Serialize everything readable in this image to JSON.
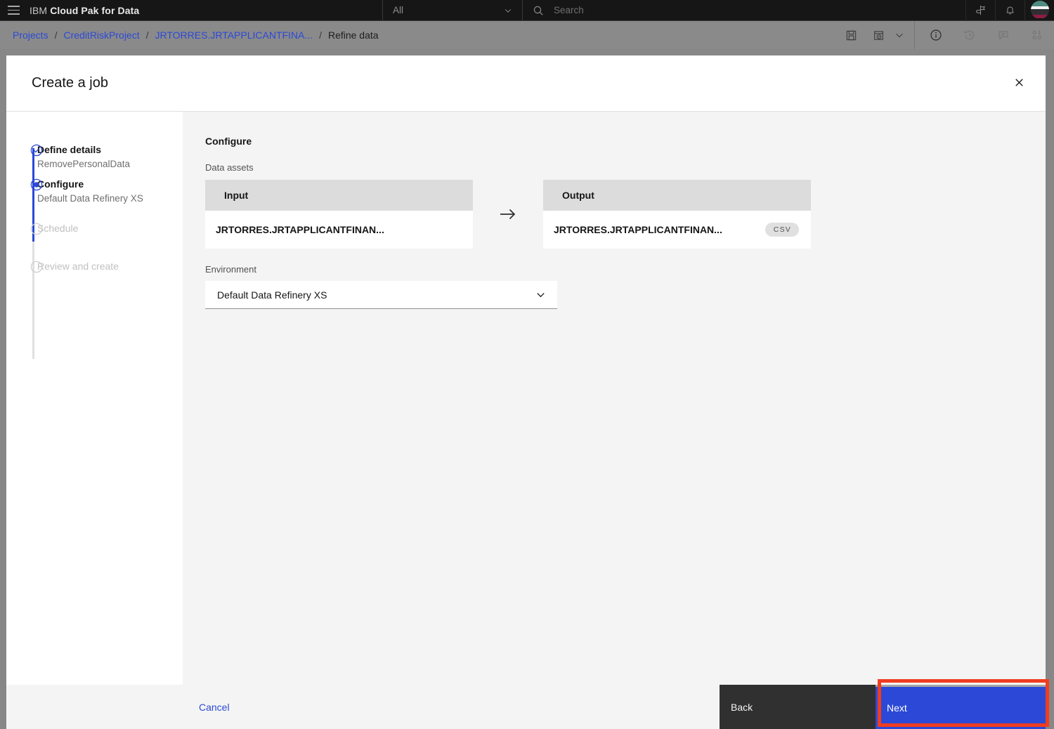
{
  "top_nav": {
    "brand_prefix": "IBM",
    "brand_name": "Cloud Pak for Data",
    "scope_select": "All",
    "search_placeholder": "Search",
    "icons": [
      "menu-icon",
      "chevron-down-icon",
      "search-icon",
      "sign-post-icon",
      "notification-bell-icon",
      "user-avatar"
    ]
  },
  "breadcrumb": {
    "items": [
      {
        "label": "Projects",
        "type": "link"
      },
      {
        "label": "CreditRiskProject",
        "type": "link"
      },
      {
        "label": "JRTORRES.JRTAPPLICANTFINA...",
        "type": "link"
      },
      {
        "label": "Refine data",
        "type": "current"
      }
    ],
    "separator": "/",
    "tools": [
      {
        "name": "save-icon"
      },
      {
        "name": "run-job-icon"
      },
      {
        "name": "chevron-down-icon"
      },
      {
        "name": "info-icon"
      },
      {
        "name": "history-icon"
      },
      {
        "name": "comment-icon"
      },
      {
        "name": "data-binary-icon"
      }
    ]
  },
  "modal": {
    "title": "Create a job",
    "close_icon": "close-icon",
    "steps": [
      {
        "id": "define-details",
        "label": "Define details",
        "sublabel": "RemovePersonalData",
        "state": "complete",
        "icon": "check-circle-icon"
      },
      {
        "id": "configure",
        "label": "Configure",
        "sublabel": "Default Data Refinery XS",
        "state": "current",
        "icon": "radio-selected-icon"
      },
      {
        "id": "schedule",
        "label": "Schedule",
        "sublabel": "",
        "state": "disabled",
        "icon": "radio-empty-icon"
      },
      {
        "id": "review-and-create",
        "label": "Review and create",
        "sublabel": "",
        "state": "disabled",
        "icon": "radio-empty-icon"
      }
    ],
    "pane": {
      "heading": "Configure",
      "data_assets_label": "Data assets",
      "input_card": {
        "header": "Input",
        "asset_name": "JRTORRES.JRTAPPLICANTFINAN..."
      },
      "flow_icon": "arrow-right-icon",
      "output_card": {
        "header": "Output",
        "asset_name": "JRTORRES.JRTAPPLICANTFINAN...",
        "format_tag": "CSV"
      },
      "environment_label": "Environment",
      "environment_value": "Default Data Refinery XS",
      "environment_chevron": "chevron-down-icon"
    },
    "footer": {
      "cancel_label": "Cancel",
      "back_label": "Back",
      "next_label": "Next"
    }
  },
  "colors": {
    "accent_blue": "#2b49d6",
    "highlight_red": "#f03c20",
    "pane_bg": "#f4f4f4",
    "card_header_bg": "#dcdcdc",
    "dark_button": "#303030"
  }
}
